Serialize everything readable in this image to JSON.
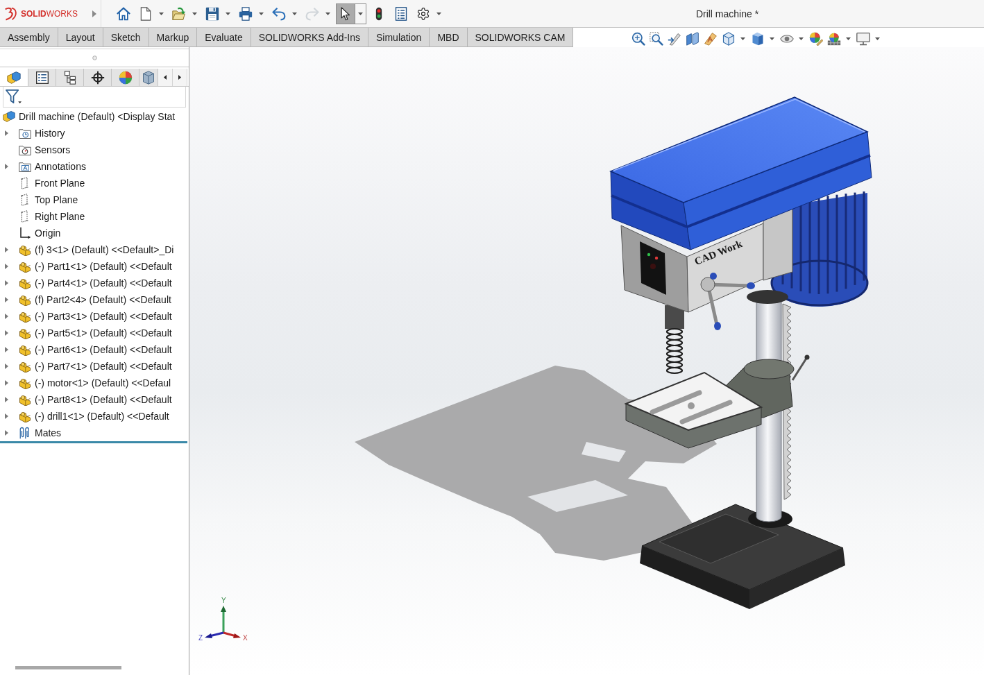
{
  "app": {
    "logo_text": "**SOLID**WORKS"
  },
  "quick_access_toolbar": [
    {
      "kind": "home",
      "menu": false,
      "active": false,
      "disabled": false
    },
    {
      "kind": "new",
      "menu": true,
      "active": false,
      "disabled": false
    },
    {
      "kind": "open",
      "menu": true,
      "active": false,
      "disabled": false
    },
    {
      "kind": "save",
      "menu": true,
      "active": false,
      "disabled": false
    },
    {
      "kind": "print",
      "menu": true,
      "active": false,
      "disabled": false
    },
    {
      "kind": "undo",
      "menu": true,
      "active": false,
      "disabled": false
    },
    {
      "kind": "redo",
      "menu": true,
      "active": false,
      "disabled": true
    },
    {
      "kind": "select",
      "menu": true,
      "active": true,
      "disabled": false
    },
    {
      "kind": "rebuild",
      "menu": false,
      "active": false,
      "disabled": false
    },
    {
      "kind": "properties",
      "menu": false,
      "active": false,
      "disabled": false
    },
    {
      "kind": "options",
      "menu": true,
      "active": false,
      "disabled": false
    }
  ],
  "window": {
    "title": "Drill machine *"
  },
  "command_tabs": [
    {
      "label": "Assembly",
      "selected": false
    },
    {
      "label": "Layout",
      "selected": false
    },
    {
      "label": "Sketch",
      "selected": false
    },
    {
      "label": "Markup",
      "selected": false
    },
    {
      "label": "Evaluate",
      "selected": false
    },
    {
      "label": "SOLIDWORKS Add-Ins",
      "selected": false
    },
    {
      "label": "Simulation",
      "selected": false
    },
    {
      "label": "MBD",
      "selected": false
    },
    {
      "label": "SOLIDWORKS CAM",
      "selected": false
    }
  ],
  "view_toolbar": [
    {
      "kind": "zoom_fit",
      "menu": false
    },
    {
      "kind": "zoom_area",
      "menu": false
    },
    {
      "kind": "previous_view",
      "menu": false
    },
    {
      "kind": "section_view",
      "menu": false
    },
    {
      "kind": "dynamic_annotation",
      "menu": false
    },
    {
      "kind": "view_orientation",
      "menu": true
    },
    {
      "kind": "display_style",
      "menu": true
    },
    {
      "kind": "hide_show",
      "menu": true
    },
    {
      "kind": "edit_appearance",
      "menu": false
    },
    {
      "kind": "apply_scene",
      "menu": true
    },
    {
      "kind": "view_settings",
      "menu": true
    }
  ],
  "manager_tabs": [
    {
      "kind": "feature_tree",
      "selected": true
    },
    {
      "kind": "property",
      "selected": false
    },
    {
      "kind": "configuration",
      "selected": false
    },
    {
      "kind": "dimxpert",
      "selected": false
    },
    {
      "kind": "display",
      "selected": false
    },
    {
      "kind": "cam",
      "selected": false
    }
  ],
  "feature_tree": {
    "root": {
      "kind": "assembly",
      "label": "Drill machine (Default) <Display Stat",
      "children": [
        {
          "kind": "history",
          "label": "History",
          "expandable": true
        },
        {
          "kind": "sensors",
          "label": "Sensors",
          "expandable": false
        },
        {
          "kind": "annotations",
          "label": "Annotations",
          "expandable": true
        },
        {
          "kind": "plane",
          "label": "Front Plane",
          "expandable": false
        },
        {
          "kind": "plane",
          "label": "Top Plane",
          "expandable": false
        },
        {
          "kind": "plane",
          "label": "Right Plane",
          "expandable": false
        },
        {
          "kind": "origin",
          "label": "Origin",
          "expandable": false
        },
        {
          "kind": "part",
          "label": "(f) 3<1> (Default) <<Default>_Di",
          "expandable": true
        },
        {
          "kind": "part",
          "label": "(-) Part1<1> (Default) <<Default",
          "expandable": true
        },
        {
          "kind": "part",
          "label": "(-) Part4<1> (Default) <<Default",
          "expandable": true
        },
        {
          "kind": "part",
          "label": "(f) Part2<4> (Default) <<Default",
          "expandable": true
        },
        {
          "kind": "part",
          "label": "(-) Part3<1> (Default) <<Default",
          "expandable": true
        },
        {
          "kind": "part",
          "label": "(-) Part5<1> (Default) <<Default",
          "expandable": true
        },
        {
          "kind": "part",
          "label": "(-) Part6<1> (Default) <<Default",
          "expandable": true
        },
        {
          "kind": "part",
          "label": "(-) Part7<1> (Default) <<Default",
          "expandable": true
        },
        {
          "kind": "part",
          "label": "(-) motor<1> (Default) <<Defaul",
          "expandable": true
        },
        {
          "kind": "part",
          "label": "(-) Part8<1> (Default) <<Default",
          "expandable": true
        },
        {
          "kind": "part",
          "label": "(-) drill1<1> (Default) <<Default",
          "expandable": true
        },
        {
          "kind": "mates",
          "label": "Mates",
          "expandable": true
        }
      ]
    }
  },
  "viewport": {
    "model": {
      "label": "CAD Work"
    },
    "triad": {
      "x_label": "X",
      "y_label": "Y",
      "z_label": "Z"
    }
  }
}
